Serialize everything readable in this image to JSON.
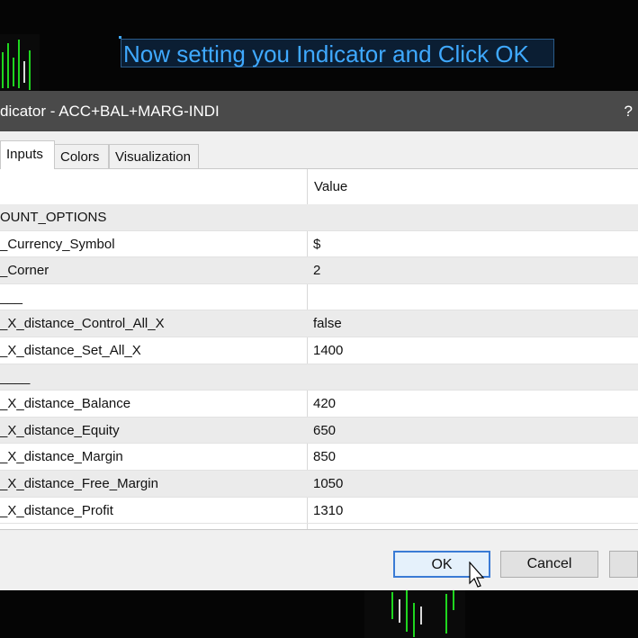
{
  "banner": {
    "text": "Now setting you Indicator and Click OK"
  },
  "dialog": {
    "title": "dicator - ACC+BAL+MARG-INDI",
    "help": "?",
    "tabs": [
      {
        "label": "Inputs",
        "active": true
      },
      {
        "label": "Colors",
        "active": false
      },
      {
        "label": "Visualization",
        "active": false
      }
    ],
    "grid": {
      "columns": [
        "",
        "Value"
      ],
      "rows": [
        {
          "key": "OUNT_OPTIONS",
          "value": ""
        },
        {
          "key": "_Currency_Symbol",
          "value": "$"
        },
        {
          "key": "_Corner",
          "value": "2"
        },
        {
          "key": "___",
          "value": ""
        },
        {
          "key": "_X_distance_Control_All_X",
          "value": "false"
        },
        {
          "key": "_X_distance_Set_All_X",
          "value": "1400"
        },
        {
          "key": "____",
          "value": ""
        },
        {
          "key": "_X_distance_Balance",
          "value": "420"
        },
        {
          "key": "_X_distance_Equity",
          "value": "650"
        },
        {
          "key": "_X_distance_Margin",
          "value": "850"
        },
        {
          "key": "_X_distance_Free_Margin",
          "value": "1050"
        },
        {
          "key": "_X_distance_Profit",
          "value": "1310"
        }
      ]
    },
    "buttons": {
      "ok": "OK",
      "cancel": "Cancel"
    }
  },
  "colors": {
    "banner_text": "#3fa9ff",
    "titlebar": "#4a4a4a",
    "candle": "#1fd61f"
  }
}
